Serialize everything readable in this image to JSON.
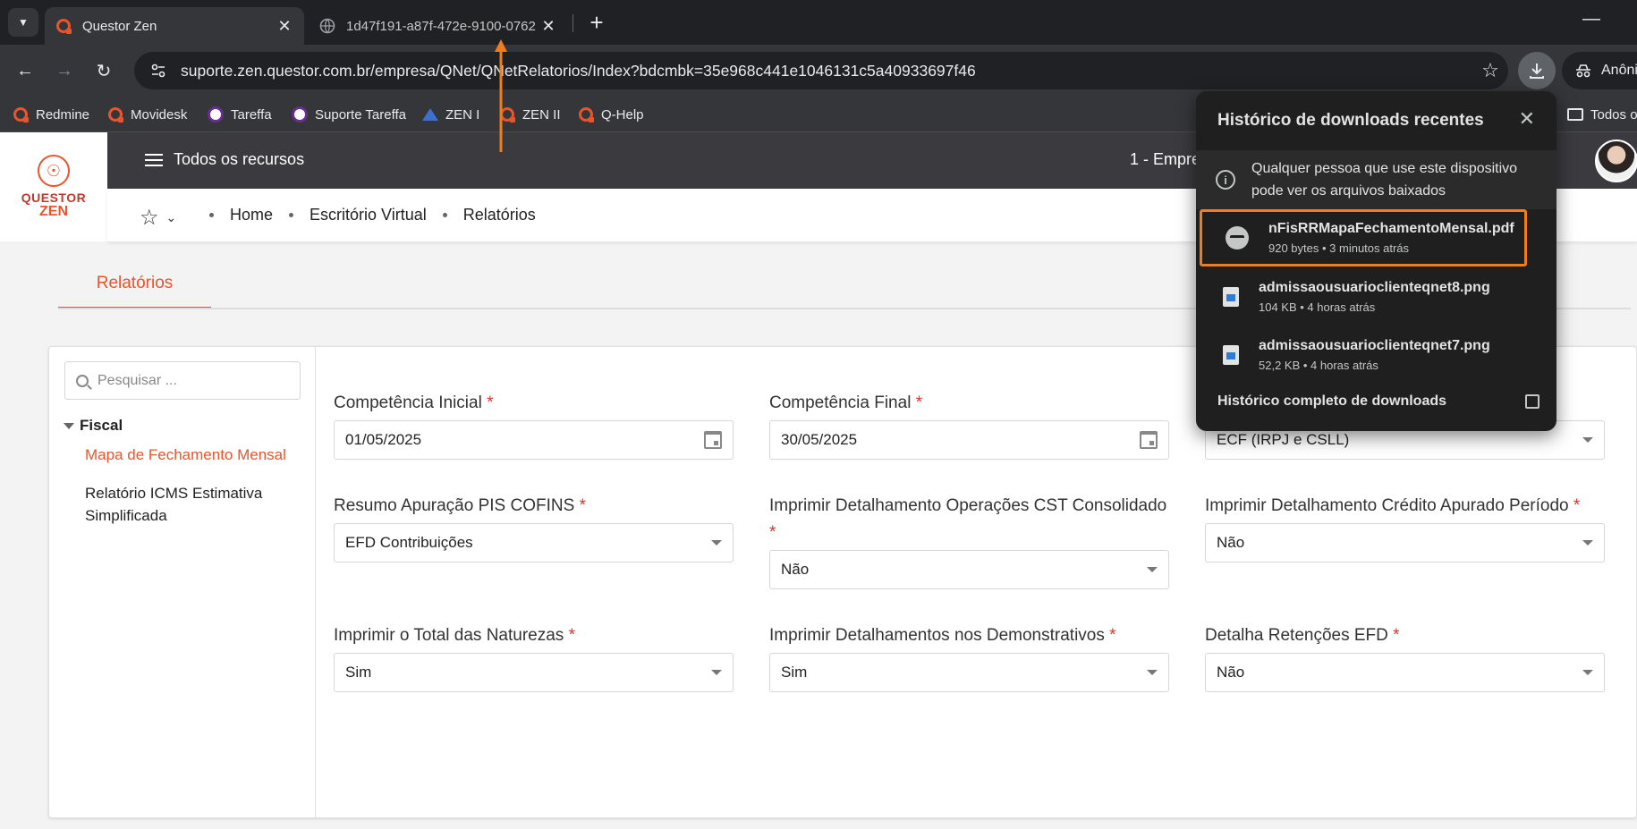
{
  "browser": {
    "tabs": [
      {
        "title": "Questor Zen",
        "active": true
      },
      {
        "title": "1d47f191-a87f-472e-9100-0762",
        "active": false
      }
    ],
    "url": "suporte.zen.questor.com.br/empresa/QNet/QNetRelatorios/Index?bdcmbk=35e968c441e1046131c5a40933697f46",
    "profile_label": "Anônima",
    "bookmarks": [
      "Redmine",
      "Movidesk",
      "Tareffa",
      "Suporte Tareffa",
      "ZEN I",
      "ZEN II",
      "Q-Help"
    ],
    "bookmarks_folder": "Todos os favoritos"
  },
  "app": {
    "logo_line1": "QUESTOR",
    "logo_line2": "ZEN",
    "menu_label": "Todos os recursos",
    "company": "1 - Empre",
    "breadcrumb": [
      "Home",
      "Escritório Virtual",
      "Relatórios"
    ],
    "tab_label": "Relatórios"
  },
  "sidebar": {
    "search_placeholder": "Pesquisar ...",
    "group": "Fiscal",
    "items": [
      {
        "label": "Mapa de Fechamento Mensal",
        "selected": true
      },
      {
        "label": "Relatório ICMS Estimativa Simplificada",
        "selected": false
      }
    ]
  },
  "form": {
    "competencia_inicial": {
      "label": "Competência Inicial",
      "value": "01/05/2025"
    },
    "competencia_final": {
      "label": "Competência Final",
      "value": "30/05/2025"
    },
    "ecf": {
      "value": "ECF (IRPJ e CSLL)"
    },
    "resumo_pis_cofins": {
      "label": "Resumo Apuração PIS COFINS",
      "value": "EFD Contribuições"
    },
    "detalhamento_cst": {
      "label": "Imprimir Detalhamento Operações CST Consolidado",
      "value": "Não"
    },
    "detalhamento_credito": {
      "label": "Imprimir Detalhamento Crédito Apurado Período",
      "value": "Não"
    },
    "total_naturezas": {
      "label": "Imprimir o Total das Naturezas",
      "value": "Sim"
    },
    "detalhamentos_demonstrativos": {
      "label": "Imprimir Detalhamentos nos Demonstrativos",
      "value": "Sim"
    },
    "retencoes_efd": {
      "label": "Detalha Retenções EFD",
      "value": "Não"
    },
    "required_mark": "*"
  },
  "downloads": {
    "title": "Histórico de downloads recentes",
    "notice": "Qualquer pessoa que use este dispositivo pode ver os arquivos baixados",
    "items": [
      {
        "name": "nFisRRMapaFechamentoMensal.pdf",
        "meta": "920 bytes • 3 minutos atrás",
        "highlighted": true
      },
      {
        "name": "admissaousuarioclienteqnet8.png",
        "meta": "104 KB • 4 horas atrás",
        "highlighted": false
      },
      {
        "name": "admissaousuarioclienteqnet7.png",
        "meta": "52,2 KB • 4 horas atrás",
        "highlighted": false
      }
    ],
    "footer": "Histórico completo de downloads"
  },
  "colors": {
    "accent": "#e8542b",
    "highlight_box": "#f07d1a",
    "annotation_arrow": "#f07d1a"
  }
}
